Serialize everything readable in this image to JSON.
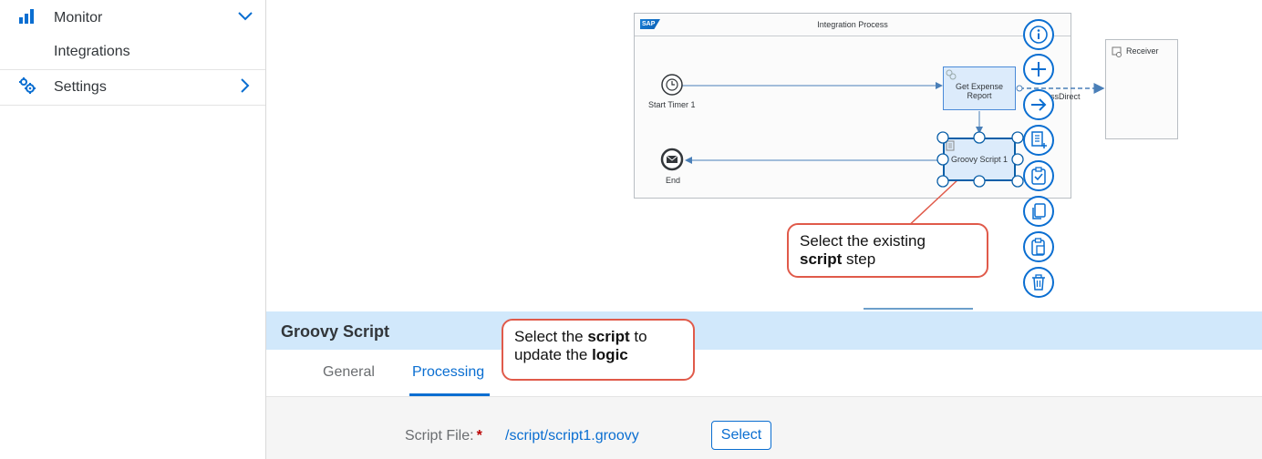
{
  "sidebar": {
    "items": [
      {
        "label": "Monitor",
        "icon": "bar-chart-icon",
        "expanded": true
      },
      {
        "label": "Integrations"
      },
      {
        "label": "Settings",
        "icon": "gears-icon"
      }
    ]
  },
  "canvas": {
    "process_title": "Integration Process",
    "sap_logo": "SAP",
    "start_label": "Start Timer 1",
    "end_label": "End",
    "step_expense": "Get Expense Report",
    "step_groovy": "Groovy Script 1",
    "receiver_label": "Receiver",
    "connection_label": "ssDirect"
  },
  "toolbar": {
    "buttons": [
      "info-icon",
      "add-icon",
      "connect-arrow-icon",
      "add-step-icon",
      "check-clipboard-icon",
      "copy-icon",
      "paste-icon",
      "delete-icon"
    ]
  },
  "callouts": {
    "step_line1": "Select the existing",
    "step_bold": "script",
    "step_rest": " step",
    "script_pre": "Select the ",
    "script_bold": "script",
    "script_post": " to",
    "script_line2_pre": "update the ",
    "script_line2_bold": "logic"
  },
  "panel": {
    "title": "Groovy Script",
    "tabs": [
      "General",
      "Processing"
    ],
    "active_tab": "Processing",
    "script_file_label": "Script File:",
    "required_mark": "*",
    "script_file_value": "/script/script1.groovy",
    "select_button": "Select"
  },
  "colors": {
    "accent": "#0a6ed1",
    "callout_border": "#e05a4a",
    "panel_header": "#d1e8fb"
  }
}
